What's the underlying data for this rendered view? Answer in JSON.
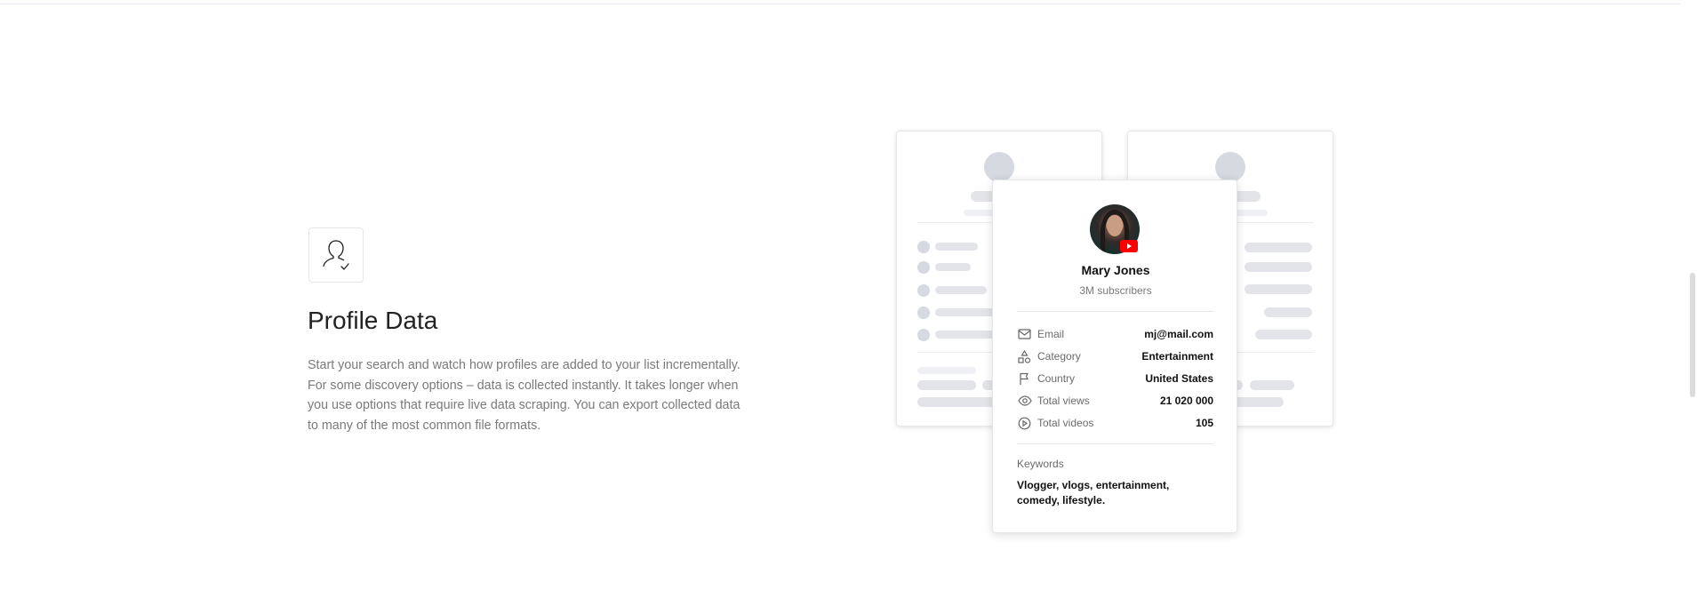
{
  "feature": {
    "icon": "user-check-icon",
    "title": "Profile Data",
    "description": "Start your search and watch how profiles are added to your list incrementally. For some discovery options – data is collected instantly. It takes longer when you use options that require live data scraping. You can export collected data to many of the most common file formats."
  },
  "profile_card": {
    "name": "Mary Jones",
    "subscribers": "3M subscribers",
    "platform_badge": "youtube-icon",
    "fields": [
      {
        "label": "Email",
        "value": "mj@mail.com",
        "icon": "mail-icon"
      },
      {
        "label": "Category",
        "value": "Entertainment",
        "icon": "shapes-icon"
      },
      {
        "label": "Country",
        "value": "United States",
        "icon": "flag-icon"
      },
      {
        "label": "Total views",
        "value": "21 020 000",
        "icon": "eye-icon"
      },
      {
        "label": "Total videos",
        "value": "105",
        "icon": "play-circle-icon"
      }
    ],
    "keywords_label": "Keywords",
    "keywords_value": "Vlogger, vlogs, entertainment, comedy, lifestyle."
  },
  "colors": {
    "youtube_red": "#ff0000",
    "skeleton": "#e2e4e9",
    "muted_text": "#7a7a7a"
  }
}
